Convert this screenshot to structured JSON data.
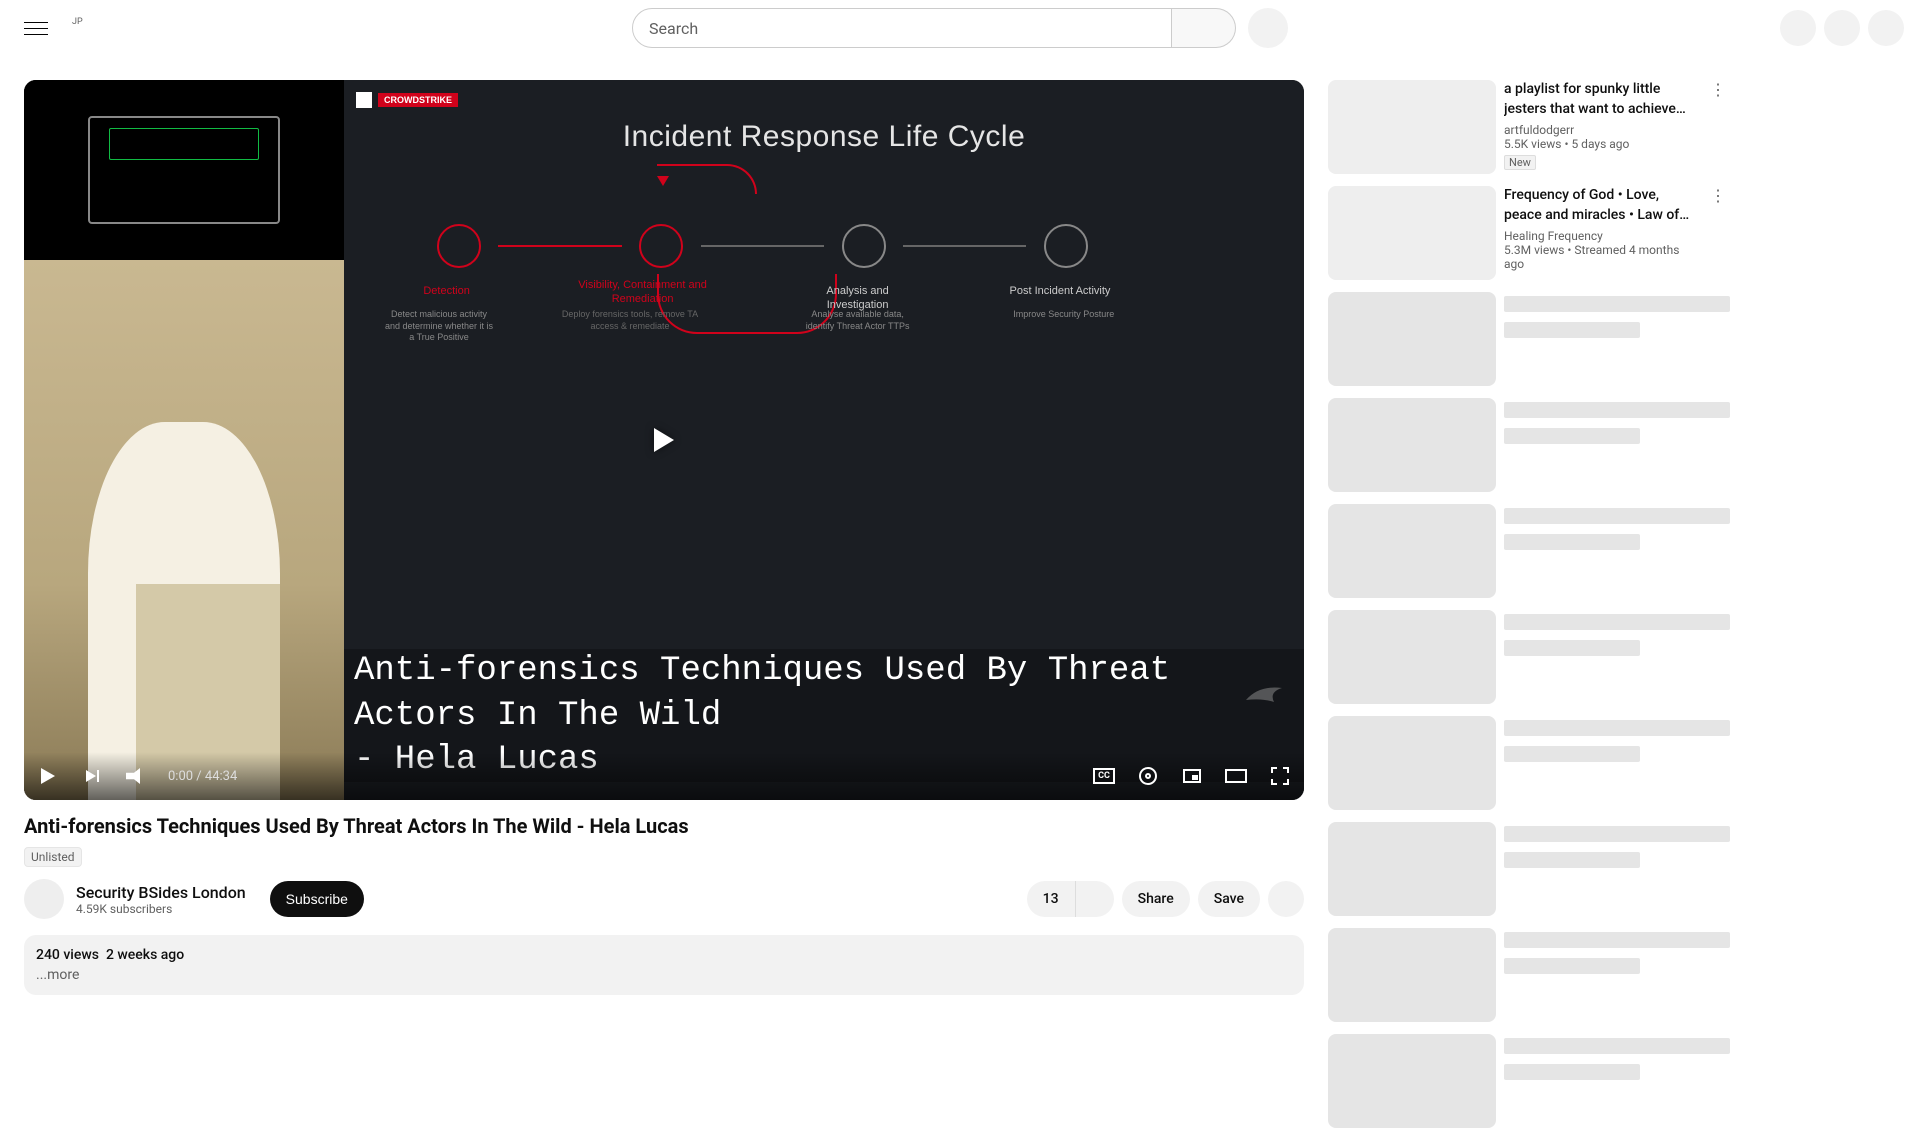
{
  "header": {
    "region_code": "JP",
    "search_placeholder": "Search"
  },
  "player": {
    "slide_badge": "CROWDSTRIKE",
    "slide_title": "Incident Response Life Cycle",
    "nodes": {
      "n1": {
        "label": "Detection",
        "desc": "Detect malicious activity and determine whether it is a True Positive"
      },
      "n2": {
        "label": "Visibility, Containment and Remediation",
        "desc": "Deploy forensics tools, remove TA access & remediate"
      },
      "n3": {
        "label": "Analysis and Investigation",
        "desc": "Analyse available data, identify Threat Actor TTPs"
      },
      "n4": {
        "label": "Post Incident Activity",
        "desc": "Improve Security Posture"
      }
    },
    "overlay_title": "Anti-forensics Techniques Used By Threat Actors In The Wild\n - Hela Lucas",
    "time_current": "0:00",
    "time_total": "44:34",
    "cc_label": "CC"
  },
  "video": {
    "title": "Anti-forensics Techniques Used By Threat Actors In The Wild - Hela Lucas",
    "visibility": "Unlisted",
    "channel_name": "Security BSides London",
    "subscribers": "4.59K subscribers",
    "subscribe_label": "Subscribe",
    "like_count": "13",
    "share_label": "Share",
    "save_label": "Save",
    "views": "240 views",
    "date": "2 weeks ago",
    "more": "...more"
  },
  "recommendations": [
    {
      "title": "a playlist for spunky little jesters that want to achieve world domination",
      "channel": "artfuldodgerr",
      "stats": "5.5K views  • 5 days ago",
      "badge": "New"
    },
    {
      "title": "Frequency of God • Love, peace and miracles • Law of attraction • Spiritual healing music",
      "channel": "Healing Frequency",
      "stats": "5.3M views  • Streamed 4 months ago",
      "badge": null
    }
  ],
  "skeleton_count": 8
}
